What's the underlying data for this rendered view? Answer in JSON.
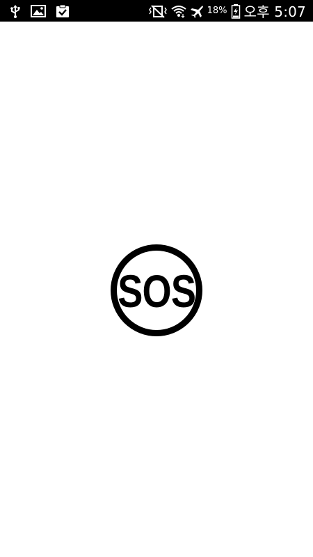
{
  "status_bar": {
    "left_icons": [
      "usb-icon",
      "image-icon",
      "clipboard-check-icon"
    ],
    "right_icons": [
      "vibrate-mute-icon",
      "wifi-icon",
      "airplane-icon",
      "battery-icon"
    ],
    "battery_percent": "18%",
    "time": "오후 5:07",
    "colors": {
      "background": "#000000",
      "foreground": "#ffffff"
    }
  },
  "content": {
    "logo": {
      "text": "SOS",
      "color": "#000000",
      "background": "#ffffff"
    }
  }
}
